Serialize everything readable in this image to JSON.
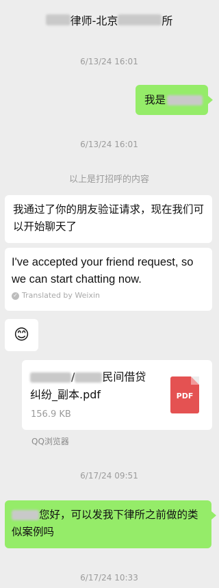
{
  "header": {
    "title_part1": "律师-北京",
    "title_part2": "所"
  },
  "messages": {
    "ts1": "6/13/24 16:01",
    "me_greeting": "我是",
    "ts2": "6/13/24 16:01",
    "system_note": "以上是打招呼的内容",
    "friend_original": "我通过了你的朋友验证请求，现在我们可以开始聊天了",
    "friend_translated": "I've accepted your friend request, so we can start chatting now.",
    "translated_by": "Translated by Weixin",
    "emoji": "😊",
    "file_name_line1": "/",
    "file_name_line1_b": "民间借贷",
    "file_name_line2": "纠纷_副本.pdf",
    "file_size": "156.9 KB",
    "file_type": "PDF",
    "file_source": "QQ浏览器",
    "ts3": "6/17/24 09:51",
    "me_question": "您好，可以发我下律所之前做的类似案例吗",
    "ts4": "6/17/24 10:33"
  },
  "colors": {
    "self_bubble": "#95ec69",
    "other_bubble": "#ffffff",
    "background": "#ededed",
    "pdf": "#e45252"
  }
}
